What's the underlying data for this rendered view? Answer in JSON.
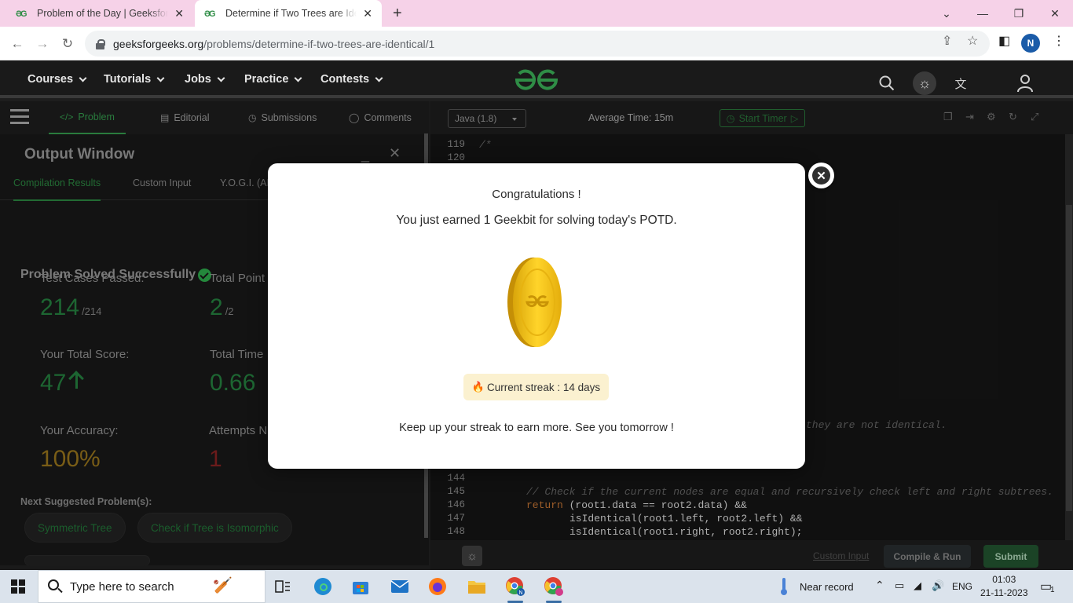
{
  "browser": {
    "tabs": [
      {
        "title": "Problem of the Day | GeeksforGeeks",
        "active": false
      },
      {
        "title": "Determine if Two Trees are Identical",
        "active": true
      }
    ],
    "url_domain": "geeksforgeeks.org",
    "url_path": "/problems/determine-if-two-trees-are-identical/1",
    "profile_initial": "N"
  },
  "gfg_nav": {
    "menus": [
      "Courses",
      "Tutorials",
      "Jobs",
      "Practice",
      "Contests"
    ],
    "logo_color": "#2f8d46"
  },
  "problem_tabs": [
    "Problem",
    "Editorial",
    "Submissions",
    "Comments"
  ],
  "output_window": {
    "title": "Output Window",
    "tabs": [
      "Compilation Results",
      "Custom Input",
      "Y.O.G.I. (AI"
    ],
    "status": "Problem Solved Successfully",
    "stats": {
      "test_cases_label": "Test Cases Passed:",
      "test_cases_value": "214",
      "test_cases_total": "/214",
      "total_points_label": "Total Point",
      "total_points_value": "2",
      "total_points_total": "/2",
      "total_score_label": "Your Total Score:",
      "total_score_value": "47",
      "total_time_label": "Total Time",
      "total_time_value": "0.66",
      "accuracy_label": "Your Accuracy:",
      "accuracy_value": "100%",
      "attempts_label": "Attempts N",
      "attempts_value": "1"
    },
    "next_label": "Next Suggested Problem(s):",
    "suggestions": [
      "Symmetric Tree",
      "Check if Tree is Isomorphic"
    ]
  },
  "editor": {
    "language": "Java (1.8)",
    "avg_time": "Average Time: 15m",
    "timer_label": "Start Timer",
    "lines_top": [
      {
        "num": "119",
        "text": "/*"
      },
      {
        "num": "120",
        "text": ""
      }
    ],
    "comment_fragment": "they are not identical.",
    "lines_bottom": [
      {
        "num": "144",
        "text": ""
      },
      {
        "num": "145",
        "text": "// Check if the current nodes are equal and recursively check left and right subtrees."
      },
      {
        "num": "146",
        "kw": "return",
        "text": " (root1.data == root2.data) &&"
      },
      {
        "num": "147",
        "text": "isIdentical(root1.left, root2.left) &&"
      },
      {
        "num": "148",
        "text": "isIdentical(root1.right, root2.right);"
      }
    ],
    "custom_input": "Custom Input",
    "compile_run": "Compile & Run",
    "submit": "Submit"
  },
  "modal": {
    "title": "Congratulations !",
    "subtitle": "You just earned 1 Geekbit for solving today's POTD.",
    "streak": "Current streak : 14 days",
    "footer": "Keep up your streak to earn more. See you tomorrow !",
    "coin_color": "#f4c21b"
  },
  "taskbar": {
    "search_placeholder": "Type here to search",
    "weather": "Near record",
    "language": "ENG",
    "time": "01:03",
    "date": "21-11-2023",
    "notifications": "1"
  }
}
